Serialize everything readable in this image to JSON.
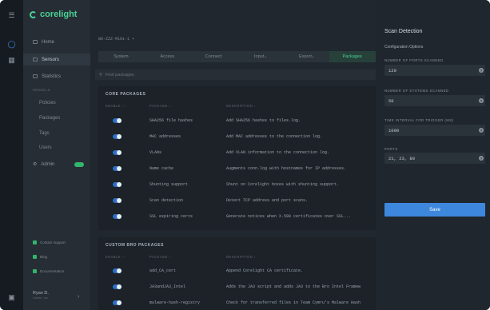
{
  "brand": {
    "name": "corelight"
  },
  "sidebar": {
    "items": [
      {
        "label": "Home",
        "icon": "home-icon"
      },
      {
        "label": "Sensors",
        "icon": "sensor-icon"
      },
      {
        "label": "Statistics",
        "icon": "chart-icon"
      }
    ],
    "section_label": "MODELS",
    "sub_items": [
      "Policies",
      "Packages",
      "Tags",
      "Users"
    ],
    "admin_label": "Admin",
    "footer": [
      "Contact support",
      "Blog",
      "Documentation"
    ],
    "user_name": "Ryan D.",
    "user_sub": "Admin, Inc"
  },
  "device": {
    "name": "WO-ZZZ-M101-1 ▾"
  },
  "tabs": [
    {
      "label": "System",
      "star": ""
    },
    {
      "label": "Access",
      "star": ""
    },
    {
      "label": "Connect",
      "star": ""
    },
    {
      "label": "Input",
      "star": "*"
    },
    {
      "label": "Export",
      "star": "*"
    },
    {
      "label": "Packages",
      "star": ""
    }
  ],
  "search": {
    "placeholder": "Find packages"
  },
  "core_packages": {
    "title": "CORE PACKAGES",
    "headers": {
      "enable": "ENABLE ↓↑",
      "package": "PACKAGE ↓",
      "description": "DESCRIPTION ↓"
    },
    "rows": [
      {
        "name": "SHA256 file hashes",
        "desc": "Add SHA256 hashes to files.log."
      },
      {
        "name": "MAC addresses",
        "desc": "Add MAC addresses to the connection log."
      },
      {
        "name": "VLANs",
        "desc": "Add VLAN information to the connection log."
      },
      {
        "name": "Name cache",
        "desc": "Augments conn.log with hostnames for IP addresses."
      },
      {
        "name": "Shunting support",
        "desc": "Shunt on Corelight boxes with shunting support."
      },
      {
        "name": "Scan detection",
        "desc": "Detect TCP address and port scans."
      },
      {
        "name": "SSL expiring certs",
        "desc": "Generate notices when X.509 certificates over SSL..."
      }
    ]
  },
  "custom_packages": {
    "title": "CUSTOM BRO PACKAGES",
    "headers": {
      "enable": "ENABLE ↓↑",
      "package": "PACKAGE ↓",
      "description": "DESCRIPTION ↓"
    },
    "rows": [
      {
        "name": "add_CA_cert",
        "desc": "Append Corelight CA certificate."
      },
      {
        "name": "JA3andJA3_Intel",
        "desc": "Adds the JA3 script and adds JA3 to the Bro Intel Framew"
      },
      {
        "name": "malware-hash-registry",
        "desc": "Check for transferred files in Team Cymru's Malware Hash"
      }
    ]
  },
  "scan_detection": {
    "title": "Scan Detection",
    "subtitle": "Configuration Options",
    "fields": [
      {
        "label": "NUMBER OF PORTS SCANNED",
        "value": "120"
      },
      {
        "label": "NUMBER OF SYSTEMS SCANNED",
        "value": "50"
      },
      {
        "label": "TIME INTERVAL FOR TRIGGER (MS)",
        "value": "1000"
      },
      {
        "label": "PORTS",
        "value": "21, 23, 80"
      }
    ],
    "help_glyph": "?",
    "save_label": "Save"
  },
  "colors": {
    "accent_green": "#4ad295",
    "toggle_blue": "#2b6fc4",
    "save_blue": "#3d87dd"
  }
}
